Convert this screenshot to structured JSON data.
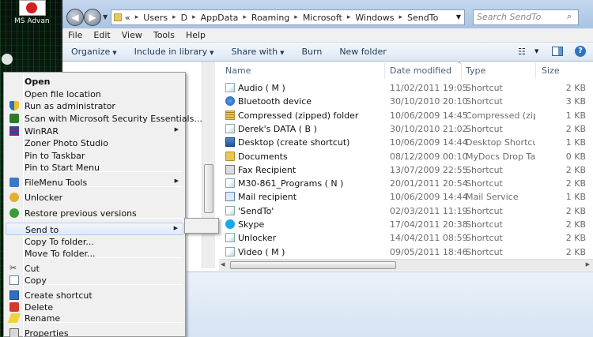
{
  "desktop": {
    "icon_label": "MS Advan"
  },
  "addressbar": {
    "overflow": "«",
    "path": [
      "Users",
      "D",
      "AppData",
      "Roaming",
      "Microsoft",
      "Windows",
      "SendTo"
    ],
    "search_placeholder": "Search SendTo"
  },
  "menubar": [
    "File",
    "Edit",
    "View",
    "Tools",
    "Help"
  ],
  "commandbar": {
    "organize": "Organize",
    "include": "Include in library",
    "share": "Share with",
    "burn": "Burn",
    "new_folder": "New folder"
  },
  "columns": {
    "name": "Name",
    "date": "Date modified",
    "type": "Type",
    "size": "Size"
  },
  "files": [
    {
      "name": "Audio ( M )",
      "date": "11/02/2011 19:05",
      "type": "Shortcut",
      "size": "2 KB",
      "icon": "shortcut-icon"
    },
    {
      "name": "Bluetooth device",
      "date": "30/10/2010 20:10",
      "type": "Shortcut",
      "size": "3 KB",
      "icon": "bluetooth-icon"
    },
    {
      "name": "Compressed (zipped) folder",
      "date": "10/06/2009 14:45",
      "type": "Compressed (zipp...",
      "size": "1 KB",
      "icon": "zip-folder-icon"
    },
    {
      "name": "Derek's DATA ( B )",
      "date": "30/10/2010 21:02",
      "type": "Shortcut",
      "size": "2 KB",
      "icon": "shortcut-icon"
    },
    {
      "name": "Desktop (create shortcut)",
      "date": "10/06/2009 14:44",
      "type": "Desktop Shortcut",
      "size": "1 KB",
      "icon": "desktop-icon"
    },
    {
      "name": "Documents",
      "date": "08/12/2009 00:10",
      "type": "MyDocs Drop Tar...",
      "size": "0 KB",
      "icon": "documents-icon"
    },
    {
      "name": "Fax Recipient",
      "date": "13/07/2009 22:55",
      "type": "Shortcut",
      "size": "2 KB",
      "icon": "fax-icon"
    },
    {
      "name": "M30-861_Programs ( N )",
      "date": "20/01/2011 20:54",
      "type": "Shortcut",
      "size": "2 KB",
      "icon": "shortcut-icon"
    },
    {
      "name": "Mail recipient",
      "date": "10/06/2009 14:44",
      "type": "Mail Service",
      "size": "1 KB",
      "icon": "mail-icon"
    },
    {
      "name": "'SendTo'",
      "date": "02/03/2011 11:19",
      "type": "Shortcut",
      "size": "2 KB",
      "icon": "shortcut-icon"
    },
    {
      "name": "Skype",
      "date": "17/04/2011 20:38",
      "type": "Shortcut",
      "size": "2 KB",
      "icon": "skype-icon"
    },
    {
      "name": "Unlocker",
      "date": "14/04/2011 08:59",
      "type": "Shortcut",
      "size": "2 KB",
      "icon": "unlocker-icon"
    },
    {
      "name": "Video ( M )",
      "date": "09/05/2011 18:46",
      "type": "Shortcut",
      "size": "2 KB",
      "icon": "shortcut-icon"
    }
  ],
  "context_menu": [
    {
      "label": "Open",
      "icon": "",
      "submenu": false
    },
    {
      "label": "Open file location",
      "icon": "",
      "submenu": false
    },
    {
      "label": "Run as administrator",
      "icon": "shield-icon",
      "submenu": false
    },
    {
      "label": "Scan with Microsoft Security Essentials...",
      "icon": "security-essentials-icon",
      "submenu": false
    },
    {
      "label": "WinRAR",
      "icon": "winrar-icon",
      "submenu": true
    },
    {
      "label": "Zoner Photo Studio",
      "icon": "",
      "submenu": false
    },
    {
      "label": "Pin to Taskbar",
      "icon": "",
      "submenu": false
    },
    {
      "label": "Pin to Start Menu",
      "icon": "",
      "submenu": false
    },
    {
      "label": "FileMenu Tools",
      "icon": "filemenu-tools-icon",
      "submenu": true
    },
    {
      "label": "Unlocker",
      "icon": "unlocker-icon",
      "submenu": false
    },
    {
      "label": "Restore previous versions",
      "icon": "restore-icon",
      "submenu": false
    },
    {
      "label": "Send to",
      "icon": "",
      "submenu": true
    },
    {
      "label": "Copy To folder...",
      "icon": "",
      "submenu": false
    },
    {
      "label": "Move To folder...",
      "icon": "",
      "submenu": false
    },
    {
      "label": "Cut",
      "icon": "cut-icon",
      "submenu": false
    },
    {
      "label": "Copy",
      "icon": "copy-icon",
      "submenu": false
    },
    {
      "label": "Create shortcut",
      "icon": "create-shortcut-icon",
      "submenu": false
    },
    {
      "label": "Delete",
      "icon": "delete-icon",
      "submenu": false
    },
    {
      "label": "Rename",
      "icon": "rename-icon",
      "submenu": false
    },
    {
      "label": "Properties",
      "icon": "properties-icon",
      "submenu": false
    }
  ],
  "colors": {
    "window_frame": "#a9c4e4",
    "menu_highlight": "#dfe9f7",
    "link_text": "#1e395b"
  }
}
